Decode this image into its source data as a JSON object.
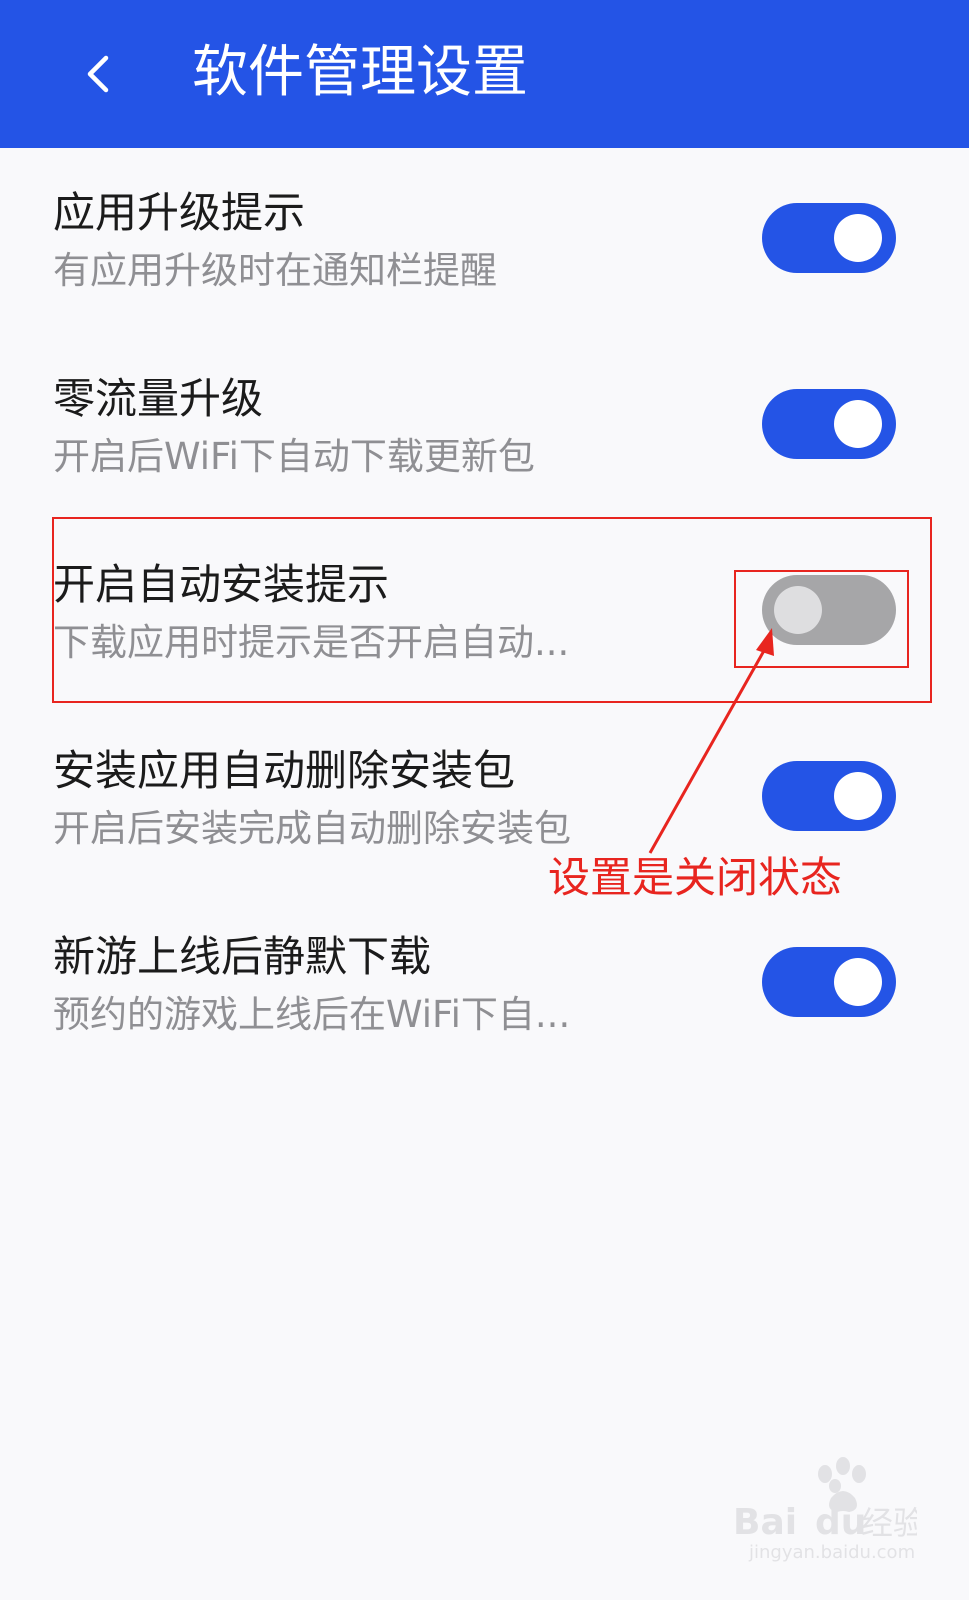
{
  "header": {
    "title": "软件管理设置",
    "back_icon": "chevron-left-icon",
    "background": "#2454e6"
  },
  "settings": [
    {
      "title": "应用升级提示",
      "subtitle": "有应用升级时在通知栏提醒",
      "enabled": true
    },
    {
      "title": "零流量升级",
      "subtitle": "开启后WiFi下自动下载更新包",
      "enabled": true
    },
    {
      "title": "开启自动安装提示",
      "subtitle": "下载应用时提示是否开启自动...",
      "enabled": false
    },
    {
      "title": "安装应用自动删除安装包",
      "subtitle": "开启后安装完成自动删除安装包",
      "enabled": true
    },
    {
      "title": "新游上线后静默下载",
      "subtitle": "预约的游戏上线后在WiFi下自...",
      "enabled": true
    }
  ],
  "annotation": {
    "text": "设置是关闭状态",
    "color": "#e8251f"
  },
  "watermark": {
    "text": "Bai du 经验",
    "url_text": "jingyan.baidu.com"
  },
  "colors": {
    "toggle_on": "#2454e6",
    "toggle_off": "#a6a6a8"
  }
}
